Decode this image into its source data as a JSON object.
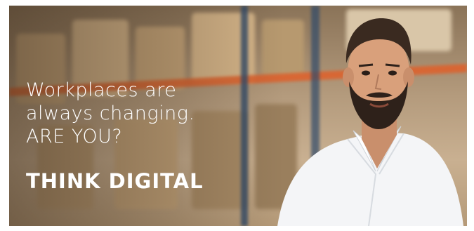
{
  "banner": {
    "headline_line1": "Workplaces are",
    "headline_line2": "always changing.",
    "headline_line3": "ARE YOU?",
    "cta": "THINK DIGITAL",
    "colors": {
      "text": "#ffffff",
      "shelf_beam": "#e0602a",
      "upright": "#2f4a6a",
      "shirt": "#f4f5f7"
    }
  }
}
